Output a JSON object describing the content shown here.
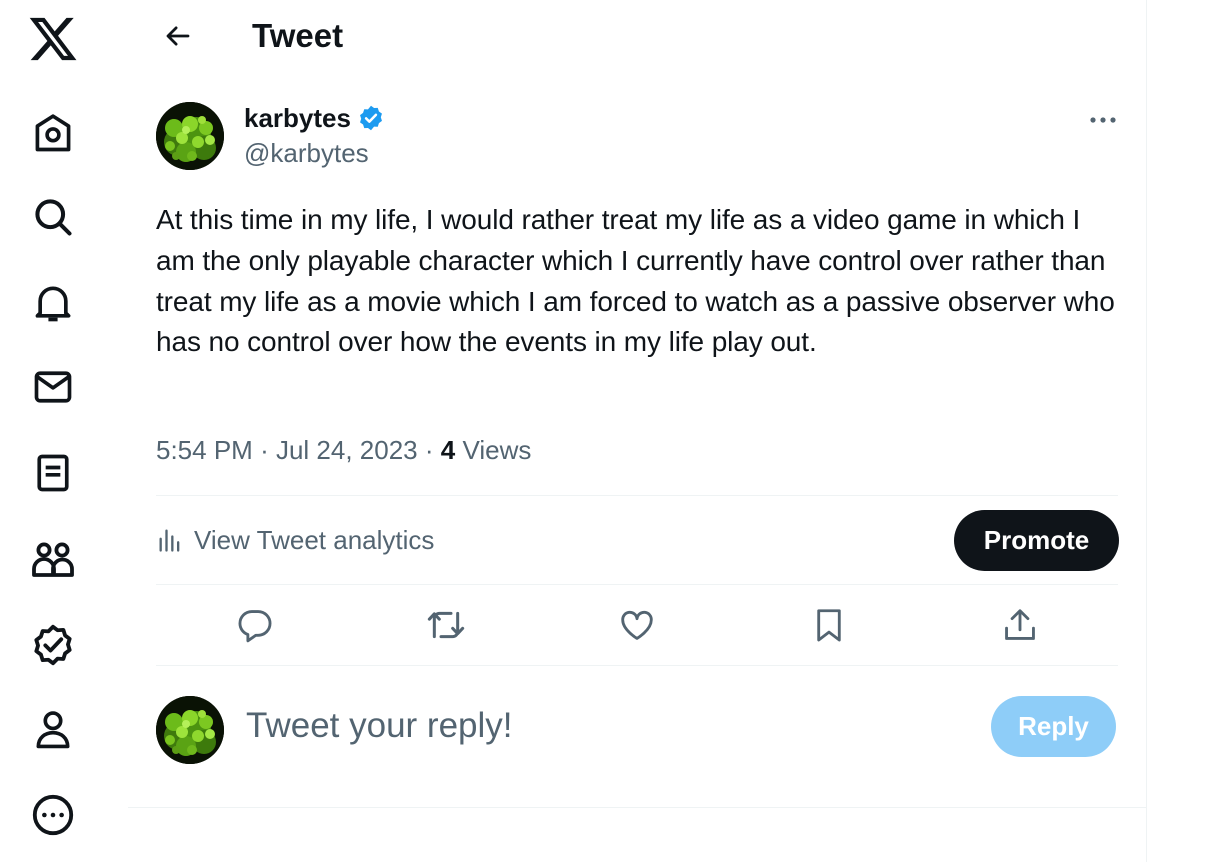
{
  "nav": {
    "items": [
      "x-logo-icon",
      "home-icon",
      "search-icon",
      "notifications-icon",
      "messages-icon",
      "lists-icon",
      "communities-icon",
      "verified-icon",
      "profile-icon",
      "more-icon"
    ]
  },
  "header": {
    "title": "Tweet"
  },
  "tweet": {
    "author_name": "karbytes",
    "author_handle": "@karbytes",
    "verified": true,
    "text": "At this time in my life, I would rather treat my life as a video game in which I am the only playable character which I currently have control over rather than treat my life as a movie which I am forced to watch as a passive observer who has no control over how the events in my life play out.",
    "time": "5:54 PM",
    "date": "Jul 24, 2023",
    "views_count": "4",
    "views_label": "Views",
    "separator": "·"
  },
  "analytics": {
    "label": "View Tweet analytics"
  },
  "promote": {
    "label": "Promote"
  },
  "actions": [
    "reply-icon",
    "retweet-icon",
    "like-icon",
    "bookmark-icon",
    "share-icon"
  ],
  "reply_box": {
    "placeholder": "Tweet your reply!",
    "button_label": "Reply"
  },
  "colors": {
    "accent": "#1d9bf0",
    "text": "#0f1419",
    "secondary": "#536471",
    "reply_disabled": "#8ecdf8",
    "divider": "#eff3f4"
  }
}
